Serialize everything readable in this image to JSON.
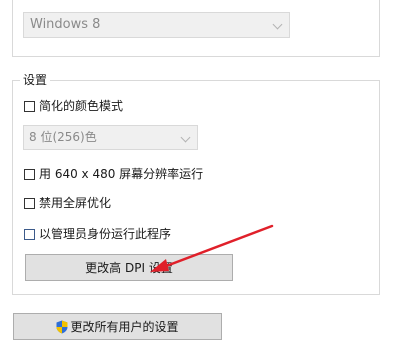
{
  "compatibility": {
    "os_select": {
      "value": "Windows 8",
      "icon": "chevron-down-icon"
    }
  },
  "settings": {
    "title": "设置",
    "reduced_color": {
      "label": "简化的颜色模式",
      "checked": false
    },
    "color_select": {
      "value": "8 位(256)色",
      "icon": "chevron-down-icon"
    },
    "low_res": {
      "label": "用 640 x 480 屏幕分辨率运行",
      "checked": false
    },
    "disable_fullscreen": {
      "label": "禁用全屏优化",
      "checked": false
    },
    "run_as_admin": {
      "label": "以管理员身份运行此程序",
      "checked": false
    },
    "dpi_button": "更改高 DPI 设置"
  },
  "footer": {
    "all_users_button": "更改所有用户的设置",
    "all_users_icon": "uac-shield-icon"
  },
  "annotation": {
    "arrow_color": "#e0202a"
  }
}
